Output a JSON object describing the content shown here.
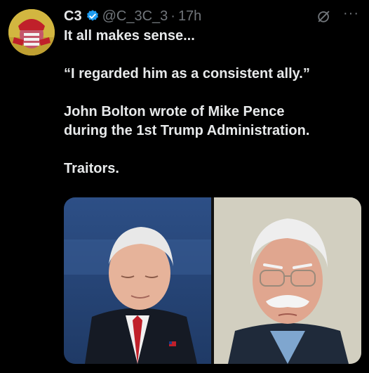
{
  "tweet": {
    "display_name": "C3",
    "handle": "@C_3C_3",
    "separator": "·",
    "time": "17h",
    "lines": [
      "It all makes sense...",
      "“I regarded him as a consistent ally.”",
      "John Bolton wrote of Mike Pence",
      "during the 1st Trump Administration.",
      "Traitors."
    ],
    "more": "···"
  },
  "colors": {
    "background": "#000000",
    "text": "#e7e9ea",
    "secondary": "#71767b",
    "verified": "#1d9bf0"
  },
  "icons": [
    "verified-badge-icon",
    "grok-icon",
    "more-icon"
  ]
}
